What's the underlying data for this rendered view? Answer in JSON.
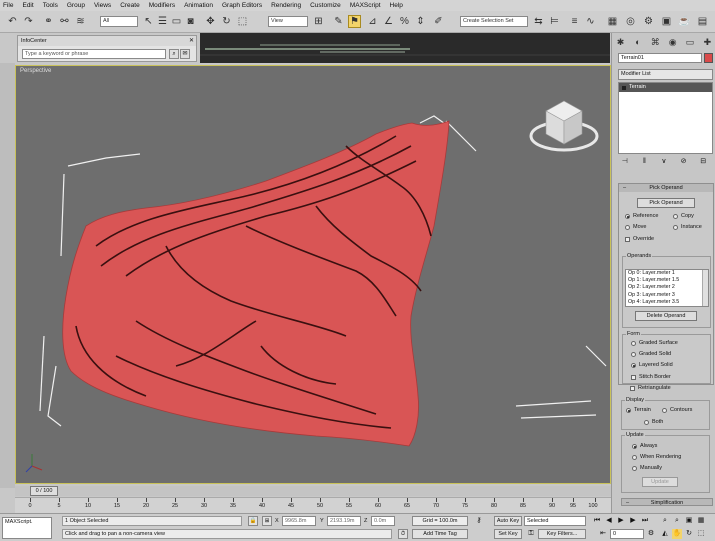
{
  "menu": [
    "File",
    "Edit",
    "Tools",
    "Group",
    "Views",
    "Create",
    "Modifiers",
    "Animation",
    "Graph Editors",
    "Rendering",
    "Customize",
    "MAXScript",
    "Help"
  ],
  "toolbar": {
    "filter_value": "All",
    "refcoord_value": "View",
    "selection_set": "Create Selection Set"
  },
  "infocenter": {
    "title": "InfoCenter",
    "search_placeholder": "Type a keyword or phrase"
  },
  "viewport": {
    "label": "Perspective",
    "terrain_color": "#d95555"
  },
  "panel": {
    "object_name": "Terrain01",
    "modifier_list": "Modifier List",
    "stack_item": "Terrain",
    "pick_operand": {
      "title": "Pick Operand",
      "button": "Pick Operand",
      "options": {
        "reference": "Reference",
        "copy": "Copy",
        "move": "Move",
        "instance": "Instance",
        "override": "Override"
      }
    },
    "operands": {
      "title": "Operands",
      "items": [
        "Op 0: Layer.meter 1",
        "Op 1: Layer.meter 1.5",
        "Op 2: Layer.meter 2",
        "Op 3: Layer.meter 3",
        "Op 4: Layer.meter 3.5"
      ],
      "delete_button": "Delete Operand"
    },
    "form": {
      "title": "Form",
      "graded_surface": "Graded Surface",
      "graded_solid": "Graded Solid",
      "layered_solid": "Layered Solid",
      "stitch_border": "Stitch Border",
      "retriangulate": "Retriangulate"
    },
    "display": {
      "title": "Display",
      "terrain": "Terrain",
      "contours": "Contours",
      "both": "Both"
    },
    "update": {
      "title": "Update",
      "always": "Always",
      "when_rendering": "When Rendering",
      "manually": "Manually",
      "button": "Update"
    },
    "simplification": "Simplification"
  },
  "timeline": {
    "slider": "0 / 100",
    "ticks": [
      "0",
      "5",
      "10",
      "15",
      "20",
      "25",
      "30",
      "35",
      "40",
      "45",
      "50",
      "55",
      "60",
      "65",
      "70",
      "75",
      "80",
      "85",
      "90",
      "95",
      "100"
    ]
  },
  "status": {
    "maxscript": "MAXScript.",
    "selection": "1 Object Selected",
    "prompt": "Click and drag to pan a non-camera view",
    "x_label": "X",
    "x_value": "9965.8m",
    "y_label": "Y",
    "y_value": "2193.19m",
    "z_label": "Z",
    "z_value": "0.0m",
    "grid": "Grid = 100.0m",
    "add_time_tag": "Add Time Tag",
    "auto_key": "Auto Key",
    "selected": "Selected",
    "set_key": "Set Key",
    "key_filters": "Key Filters...",
    "frame": "0"
  }
}
